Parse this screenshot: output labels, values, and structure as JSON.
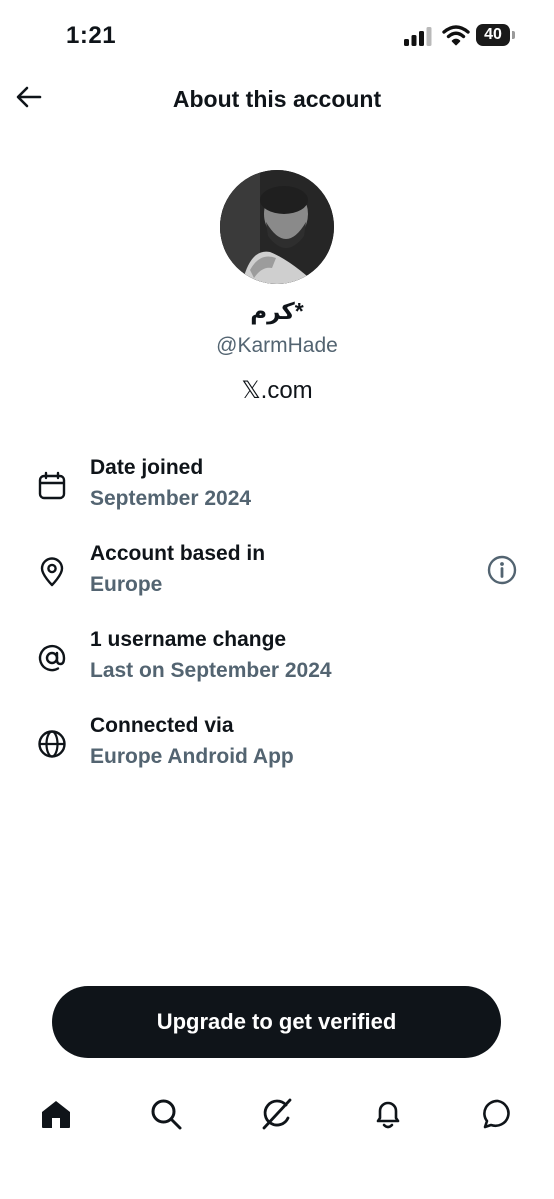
{
  "status_bar": {
    "time": "1:21",
    "battery": "40"
  },
  "header": {
    "title": "About this account"
  },
  "profile": {
    "display_name": "كرم*",
    "handle": "@KarmHade",
    "website": "𝕏.com"
  },
  "info": [
    {
      "title": "Date joined",
      "value": "September 2024",
      "icon": "calendar-icon"
    },
    {
      "title": "Account based in",
      "value": "Europe",
      "icon": "location-pin-icon"
    },
    {
      "title": "1 username change",
      "value": "Last on September 2024",
      "icon": "at-sign-icon"
    },
    {
      "title": "Connected via",
      "value": "Europe Android App",
      "icon": "globe-icon"
    }
  ],
  "cta": {
    "label": "Upgrade to get verified"
  },
  "tabbar": {
    "icons": [
      "home-icon",
      "search-icon",
      "grok-icon",
      "bell-icon",
      "messages-icon"
    ]
  }
}
